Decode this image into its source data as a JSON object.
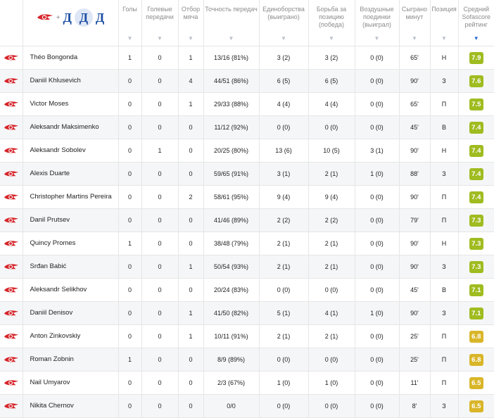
{
  "colors": {
    "rating_green": "#9fbc20",
    "rating_yellow": "#d9b629",
    "spartak_red": "#d6262b",
    "dynamo_blue": "#1c4ea3",
    "sort_active": "#2c6ad6"
  },
  "filter": {
    "plus": "+",
    "dynamo_letter": "Д"
  },
  "headers": {
    "goals": "Голы",
    "assists": "Голевые передачи",
    "tackles": "Отбор мяча",
    "pass_acc": "Точность передач",
    "duels": "Единоборства (выиграно)",
    "ground_duels": "Борьба за позицию (победа)",
    "aerial_duels": "Воздушные поединки (выиграл)",
    "minutes": "Сыграно минут",
    "position": "Позиция",
    "rating": "Средний Sofascore рейтинг",
    "sort_icon": "▼"
  },
  "players": [
    {
      "name": "Théo Bongonda",
      "goals": "1",
      "assists": "0",
      "tackles": "1",
      "pass": "13/16 (81%)",
      "duels": "3 (2)",
      "ground": "3 (2)",
      "aerial": "0 (0)",
      "minutes": "65'",
      "position": "Н",
      "rating": "7.9",
      "color": "#9fbc20"
    },
    {
      "name": "Daniil Khlusevich",
      "goals": "0",
      "assists": "0",
      "tackles": "4",
      "pass": "44/51 (86%)",
      "duels": "6 (5)",
      "ground": "6 (5)",
      "aerial": "0 (0)",
      "minutes": "90'",
      "position": "З",
      "rating": "7.6",
      "color": "#9fbc20"
    },
    {
      "name": "Victor Moses",
      "goals": "0",
      "assists": "0",
      "tackles": "1",
      "pass": "29/33 (88%)",
      "duels": "4 (4)",
      "ground": "4 (4)",
      "aerial": "0 (0)",
      "minutes": "65'",
      "position": "П",
      "rating": "7.5",
      "color": "#9fbc20"
    },
    {
      "name": "Aleksandr Maksimenko",
      "goals": "0",
      "assists": "0",
      "tackles": "0",
      "pass": "11/12 (92%)",
      "duels": "0 (0)",
      "ground": "0 (0)",
      "aerial": "0 (0)",
      "minutes": "45'",
      "position": "В",
      "rating": "7.4",
      "color": "#9fbc20"
    },
    {
      "name": "Aleksandr Sobolev",
      "goals": "0",
      "assists": "1",
      "tackles": "0",
      "pass": "20/25 (80%)",
      "duels": "13 (6)",
      "ground": "10 (5)",
      "aerial": "3 (1)",
      "minutes": "90'",
      "position": "Н",
      "rating": "7.4",
      "color": "#9fbc20"
    },
    {
      "name": "Alexis Duarte",
      "goals": "0",
      "assists": "0",
      "tackles": "0",
      "pass": "59/65 (91%)",
      "duels": "3 (1)",
      "ground": "2 (1)",
      "aerial": "1 (0)",
      "minutes": "88'",
      "position": "З",
      "rating": "7.4",
      "color": "#9fbc20"
    },
    {
      "name": "Christopher Martins Pereira",
      "goals": "0",
      "assists": "0",
      "tackles": "2",
      "pass": "58/61 (95%)",
      "duels": "9 (4)",
      "ground": "9 (4)",
      "aerial": "0 (0)",
      "minutes": "90'",
      "position": "П",
      "rating": "7.4",
      "color": "#9fbc20"
    },
    {
      "name": "Danil Prutsev",
      "goals": "0",
      "assists": "0",
      "tackles": "0",
      "pass": "41/46 (89%)",
      "duels": "2 (2)",
      "ground": "2 (2)",
      "aerial": "0 (0)",
      "minutes": "79'",
      "position": "П",
      "rating": "7.3",
      "color": "#9fbc20"
    },
    {
      "name": "Quincy Promes",
      "goals": "1",
      "assists": "0",
      "tackles": "0",
      "pass": "38/48 (79%)",
      "duels": "2 (1)",
      "ground": "2 (1)",
      "aerial": "0 (0)",
      "minutes": "90'",
      "position": "Н",
      "rating": "7.3",
      "color": "#9fbc20"
    },
    {
      "name": "Srđan Babić",
      "goals": "0",
      "assists": "0",
      "tackles": "1",
      "pass": "50/54 (93%)",
      "duels": "2 (1)",
      "ground": "2 (1)",
      "aerial": "0 (0)",
      "minutes": "90'",
      "position": "З",
      "rating": "7.3",
      "color": "#9fbc20"
    },
    {
      "name": "Aleksandr Selikhov",
      "goals": "0",
      "assists": "0",
      "tackles": "0",
      "pass": "20/24 (83%)",
      "duels": "0 (0)",
      "ground": "0 (0)",
      "aerial": "0 (0)",
      "minutes": "45'",
      "position": "В",
      "rating": "7.1",
      "color": "#9fbc20"
    },
    {
      "name": "Daniil Denisov",
      "goals": "0",
      "assists": "0",
      "tackles": "1",
      "pass": "41/50 (82%)",
      "duels": "5 (1)",
      "ground": "4 (1)",
      "aerial": "1 (0)",
      "minutes": "90'",
      "position": "З",
      "rating": "7.1",
      "color": "#9fbc20"
    },
    {
      "name": "Anton Zinkovskiy",
      "goals": "0",
      "assists": "0",
      "tackles": "1",
      "pass": "10/11 (91%)",
      "duels": "2 (1)",
      "ground": "2 (1)",
      "aerial": "0 (0)",
      "minutes": "25'",
      "position": "П",
      "rating": "6.8",
      "color": "#d9b629"
    },
    {
      "name": "Roman Zobnin",
      "goals": "1",
      "assists": "0",
      "tackles": "0",
      "pass": "8/9 (89%)",
      "duels": "0 (0)",
      "ground": "0 (0)",
      "aerial": "0 (0)",
      "minutes": "25'",
      "position": "П",
      "rating": "6.8",
      "color": "#d9b629"
    },
    {
      "name": "Nail Umyarov",
      "goals": "0",
      "assists": "0",
      "tackles": "0",
      "pass": "2/3 (67%)",
      "duels": "1 (0)",
      "ground": "1 (0)",
      "aerial": "0 (0)",
      "minutes": "11'",
      "position": "П",
      "rating": "6.5",
      "color": "#d9b629"
    },
    {
      "name": "Nikita Chernov",
      "goals": "0",
      "assists": "0",
      "tackles": "0",
      "pass": "0/0",
      "duels": "0 (0)",
      "ground": "0 (0)",
      "aerial": "0 (0)",
      "minutes": "8'",
      "position": "З",
      "rating": "6.5",
      "color": "#d9b629"
    }
  ]
}
